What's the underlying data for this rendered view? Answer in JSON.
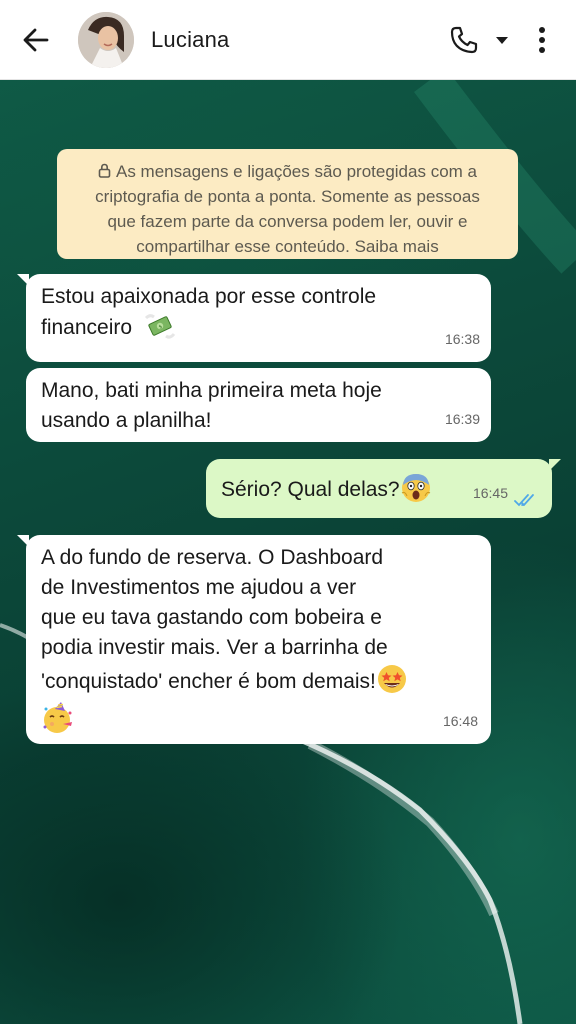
{
  "header": {
    "contact_name": "Luciana",
    "icons": {
      "back": "arrow-back-icon",
      "call": "phone-icon",
      "dropdown": "caret-down-icon",
      "menu": "more-vertical-icon"
    }
  },
  "encryption_notice": {
    "line1": "As mensagens e ligações são protegidas com a",
    "line2": "criptografia de ponta a ponta. Somente as pessoas",
    "line3": "que fazem parte da conversa podem ler, ouvir e",
    "line4": "compartilhar esse conteúdo.",
    "link": "Saiba mais"
  },
  "messages": [
    {
      "direction": "incoming",
      "lines": [
        "Estou apaixonada por esse controle",
        "financeiro"
      ],
      "emoji": "flying-money-emoji",
      "time": "16:38"
    },
    {
      "direction": "incoming",
      "lines": [
        "Mano, bati minha primeira meta hoje",
        "usando a planilha!"
      ],
      "time": "16:39"
    },
    {
      "direction": "outgoing",
      "lines": [
        "Sério? Qual delas?"
      ],
      "emoji": "screaming-face-emoji",
      "time": "16:45",
      "status": "read-double-check"
    },
    {
      "direction": "incoming",
      "lines": [
        "A do fundo de reserva. O Dashboard",
        "de Investimentos me ajudou a ver",
        "que eu tava gastando com bobeira e",
        "podia investir mais. Ver a barrinha de",
        "'conquistado' encher é bom demais!"
      ],
      "emojis": [
        "star-struck-emoji",
        "partying-face-emoji"
      ],
      "time": "16:48"
    }
  ],
  "colors": {
    "incoming_bubble": "#ffffff",
    "outgoing_bubble": "#dcf8c6",
    "notice_bg": "#fcebc3",
    "read_ticks": "#4fa8e8"
  }
}
